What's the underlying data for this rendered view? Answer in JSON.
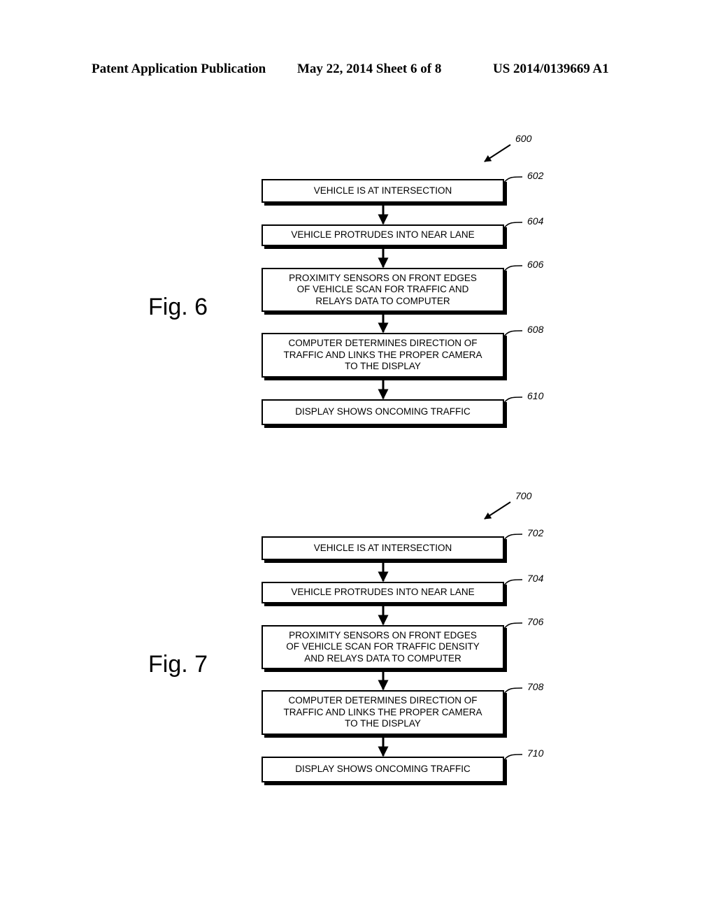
{
  "header": {
    "publication": "Patent Application Publication",
    "date_sheet": "May 22, 2014  Sheet 6 of 8",
    "patent_number": "US 2014/0139669 A1"
  },
  "figures": [
    {
      "label": "Fig. 6",
      "ref": "600",
      "steps": [
        {
          "ref": "602",
          "lines": [
            "VEHICLE IS AT INTERSECTION"
          ]
        },
        {
          "ref": "604",
          "lines": [
            "VEHICLE PROTRUDES INTO NEAR LANE"
          ]
        },
        {
          "ref": "606",
          "lines": [
            "PROXIMITY SENSORS ON FRONT EDGES",
            "OF VEHICLE SCAN FOR TRAFFIC AND",
            "RELAYS DATA TO COMPUTER"
          ]
        },
        {
          "ref": "608",
          "lines": [
            "COMPUTER DETERMINES DIRECTION OF",
            "TRAFFIC AND LINKS THE PROPER CAMERA",
            "TO THE DISPLAY"
          ]
        },
        {
          "ref": "610",
          "lines": [
            "DISPLAY SHOWS ONCOMING TRAFFIC"
          ]
        }
      ]
    },
    {
      "label": "Fig. 7",
      "ref": "700",
      "steps": [
        {
          "ref": "702",
          "lines": [
            "VEHICLE IS AT INTERSECTION"
          ]
        },
        {
          "ref": "704",
          "lines": [
            "VEHICLE PROTRUDES INTO NEAR LANE"
          ]
        },
        {
          "ref": "706",
          "lines": [
            "PROXIMITY SENSORS ON FRONT EDGES",
            "OF VEHICLE SCAN FOR TRAFFIC DENSITY",
            "AND RELAYS DATA TO COMPUTER"
          ]
        },
        {
          "ref": "708",
          "lines": [
            "COMPUTER DETERMINES DIRECTION OF",
            "TRAFFIC AND LINKS THE PROPER CAMERA",
            "TO THE DISPLAY"
          ]
        },
        {
          "ref": "710",
          "lines": [
            "DISPLAY SHOWS ONCOMING TRAFFIC"
          ]
        }
      ]
    }
  ]
}
